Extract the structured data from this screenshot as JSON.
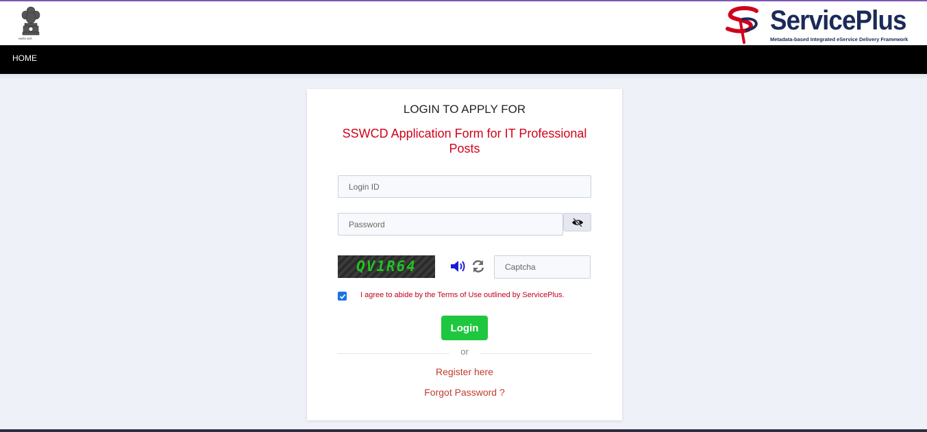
{
  "header": {
    "emblem_caption": "सत्यमेव जयते",
    "brand": {
      "name": "ServicePlus",
      "tagline": "Metadata-based Integrated eService Delivery Framework",
      "color": "#1b2a59",
      "accent": "#d0021b"
    }
  },
  "nav": {
    "items": [
      {
        "label": "HOME"
      }
    ]
  },
  "card": {
    "heading": "LOGIN TO APPLY FOR",
    "service_name": "SSWCD Application Form for IT Professional Posts",
    "login_id": {
      "placeholder": "Login ID",
      "value": ""
    },
    "password": {
      "placeholder": "Password",
      "value": ""
    },
    "captcha": {
      "code": "QV1R64",
      "placeholder": "Captcha",
      "value": ""
    },
    "agree": {
      "checked": true,
      "label": "I agree to abide by the Terms of Use outlined by ServicePlus."
    },
    "login_label": "Login",
    "or_label": "or",
    "register_label": "Register here",
    "forgot_label": "Forgot Password ?"
  },
  "colors": {
    "nav_bg": "#000000",
    "page_bg": "#eef1f8",
    "login_button": "#1ec73f",
    "link": "#c0392b",
    "checkbox": "#1a73e8"
  },
  "icons": [
    "national-emblem-icon",
    "eye-slash-icon",
    "speaker-icon",
    "refresh-icon",
    "check-icon"
  ]
}
